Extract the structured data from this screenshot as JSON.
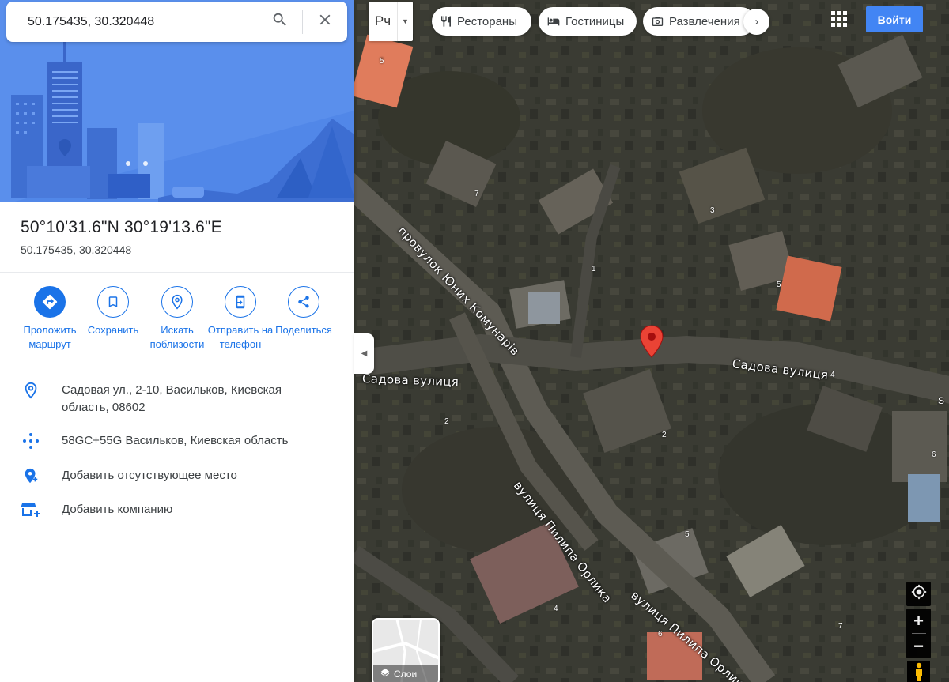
{
  "search": {
    "value": "50.175435, 30.320448"
  },
  "place": {
    "title": "50°10'31.6\"N 30°19'13.6\"E",
    "subtitle": "50.175435, 30.320448"
  },
  "actions": [
    {
      "label": "Проложить маршрут",
      "icon": "directions-icon"
    },
    {
      "label": "Сохранить",
      "icon": "bookmark-icon"
    },
    {
      "label": "Искать поблизости",
      "icon": "nearby-icon"
    },
    {
      "label": "Отправить на телефон",
      "icon": "send-to-phone-icon"
    },
    {
      "label": "Поделиться",
      "icon": "share-icon"
    }
  ],
  "info": {
    "address": "Садовая ул., 2-10, Васильков, Киевская область, 08602",
    "plus_code": "58GC+55G Васильков, Киевская область",
    "add_missing": "Добавить отсутствующее место",
    "add_business": "Добавить компанию"
  },
  "map": {
    "layer_lang": "Рч",
    "chips": [
      "Рестораны",
      "Гостиницы",
      "Развлечения"
    ],
    "signin": "Войти",
    "layers_label": "Слои",
    "streets": [
      "провулок Юних Комунарів",
      "Садова вулиця",
      "Садова вулиця",
      "вулиця Пилипа Орлика",
      "вулиця Пилипа Орлика"
    ],
    "house_numbers": [
      "5",
      "7",
      "3",
      "1",
      "5",
      "4",
      "2",
      "2",
      "5",
      "6",
      "4",
      "6",
      "7",
      "S"
    ]
  },
  "colors": {
    "accent": "#1a73e8",
    "signin": "#4285f4",
    "pin": "#ea4335",
    "hero_bg": "#5187e8"
  }
}
